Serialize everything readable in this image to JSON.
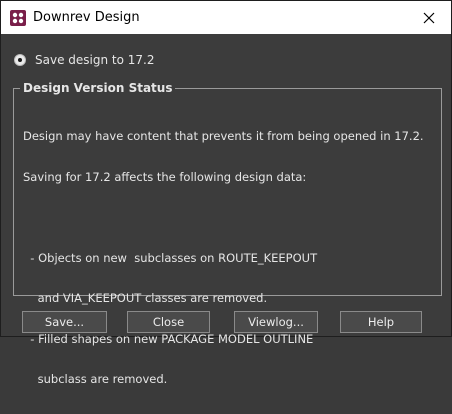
{
  "window": {
    "title": "Downrev Design"
  },
  "option": {
    "label": "Save design to 17.2",
    "selected": true
  },
  "group": {
    "title": "Design Version Status",
    "lines": [
      "Design may have content that prevents it from being opened in 17.2.",
      "Saving for 17.2 affects the following design data:",
      "",
      "  - Objects on new  subclasses on ROUTE_KEEPOUT",
      "    and VIA_KEEPOUT classes are removed.",
      "  - Filled shapes on new PACKAGE MODEL OUTLINE",
      "    subclass are removed."
    ]
  },
  "buttons": {
    "save": "Save...",
    "close": "Close",
    "viewlog": "Viewlog...",
    "help": "Help"
  },
  "icons": {
    "app": "app-icon",
    "close": "close-icon"
  }
}
